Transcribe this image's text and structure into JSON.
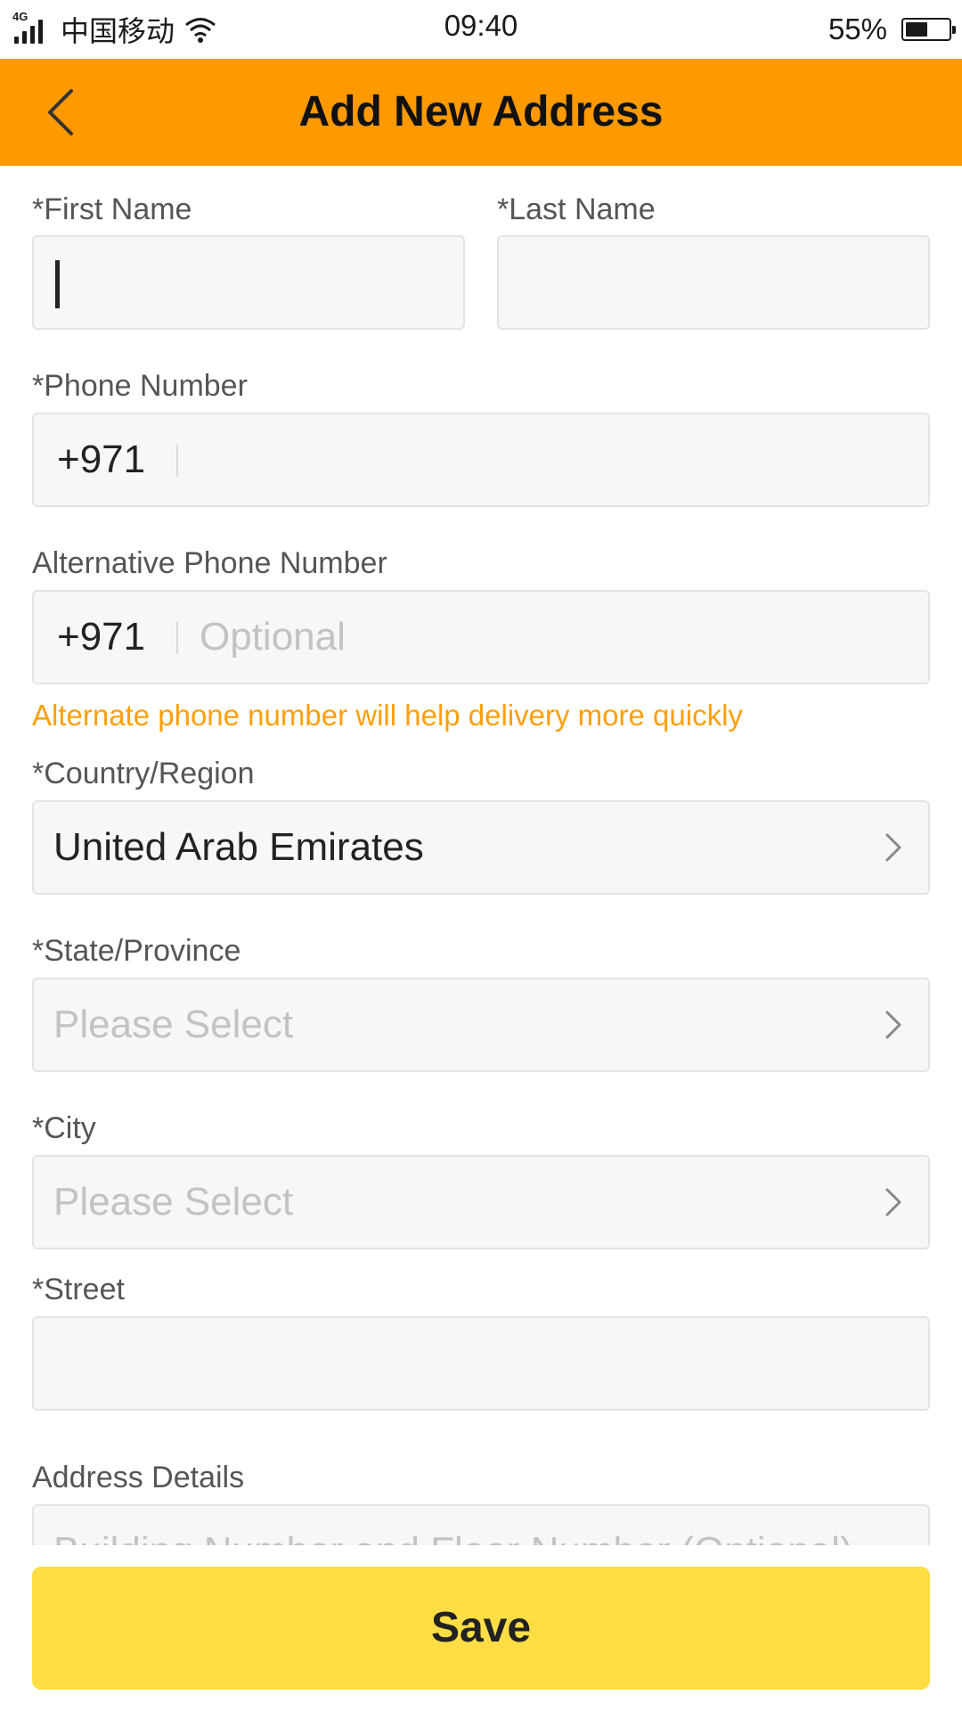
{
  "colors": {
    "header_bg": "#ff9900",
    "save_bg": "#ffdd44",
    "hint_text": "#ff9f0a",
    "field_bg": "#f6f7f6"
  },
  "status_bar": {
    "network": "4G",
    "carrier": "中国移动",
    "time": "09:40",
    "battery_percent": "55%",
    "battery_level": 0.55
  },
  "header": {
    "title": "Add New Address",
    "back_icon": "chevron-left-icon"
  },
  "form": {
    "first_name": {
      "label": "*First Name",
      "value": ""
    },
    "last_name": {
      "label": "*Last Name",
      "value": ""
    },
    "phone": {
      "label": "*Phone Number",
      "prefix": "+971",
      "value": ""
    },
    "alt_phone": {
      "label": "Alternative Phone Number",
      "prefix": "+971",
      "placeholder": "Optional",
      "hint": "Alternate phone number will help delivery more quickly"
    },
    "country": {
      "label": "*Country/Region",
      "value": "United Arab Emirates"
    },
    "state": {
      "label": "*State/Province",
      "placeholder": "Please Select"
    },
    "city": {
      "label": "*City",
      "placeholder": "Please Select"
    },
    "street": {
      "label": "*Street",
      "value": ""
    },
    "address_details": {
      "label": "Address Details",
      "placeholder": "Building Number and Floor Number (Optional)"
    }
  },
  "save_label": "Save"
}
